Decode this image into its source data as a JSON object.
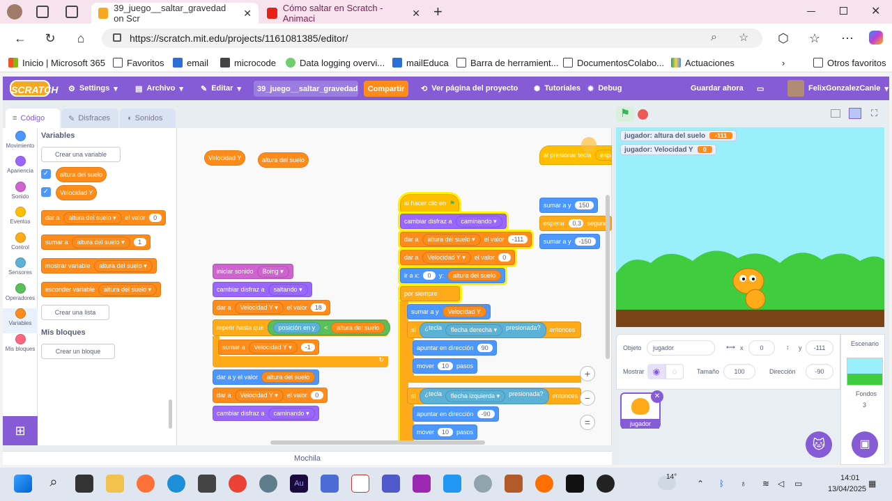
{
  "browser": {
    "tabs": [
      {
        "title": "39_juego__saltar_gravedad on Scr",
        "close": "✕"
      },
      {
        "title": "Cómo saltar en Scratch - Animaci",
        "close": "✕"
      }
    ],
    "new_tab": "+",
    "url": "https://scratch.mit.edu/projects/1161081385/editor/",
    "favorites": [
      "Inicio | Microsoft 365",
      "Favoritos",
      "email",
      "microcode",
      "Data logging overvi...",
      "mailEduca",
      "Barra de herramient...",
      "DocumentosColabo...",
      "Actuaciones"
    ],
    "other_favorites": "Otros favoritos"
  },
  "menubar": {
    "logo": "SCRATCH",
    "settings": "Settings",
    "archivo": "Archivo",
    "editar": "Editar",
    "project_title": "39_juego__saltar_gravedad",
    "share": "Compartir",
    "project_page": "Ver página del proyecto",
    "tutorials": "Tutoriales",
    "debug": "Debug",
    "save": "Guardar ahora",
    "user": "FelixGonzalezCanle"
  },
  "editor_tabs": {
    "code": "Código",
    "costumes": "Disfraces",
    "sounds": "Sonidos"
  },
  "categories": [
    {
      "label": "Movimiento",
      "color": "#4c97ff"
    },
    {
      "label": "Apariencia",
      "color": "#9966ff"
    },
    {
      "label": "Sonido",
      "color": "#cf63cf"
    },
    {
      "label": "Eventos",
      "color": "#ffbf00"
    },
    {
      "label": "Control",
      "color": "#ffab19"
    },
    {
      "label": "Sensores",
      "color": "#5cb1d6"
    },
    {
      "label": "Operadores",
      "color": "#59c059"
    },
    {
      "label": "Variables",
      "color": "#ff8c1a"
    },
    {
      "label": "Mis bloques",
      "color": "#ff6680"
    }
  ],
  "palette": {
    "variables_title": "Variables",
    "create_var": "Crear una variable",
    "var1": "altura del suelo",
    "var2": "Velocidad Y",
    "set_block": {
      "a": "dar a",
      "var": "altura del suelo",
      "b": "el valor",
      "v": "0"
    },
    "change_block": {
      "a": "sumar a",
      "var": "altura del suelo",
      "v": "1"
    },
    "show_block": {
      "a": "mostrar variable",
      "var": "altura del suelo"
    },
    "hide_block": {
      "a": "esconder variable",
      "var": "altura del suelo"
    },
    "create_list": "Crear una lista",
    "myblocks_title": "Mis bloques",
    "create_block": "Crear un bloque"
  },
  "workspace": {
    "loose1": "Velocidad Y",
    "loose2": "altura del suelo",
    "s1": {
      "sound": "iniciar sonido",
      "sound_v": "Boing",
      "costume": "cambiar disfraz a",
      "costume_v": "saltando",
      "set": "dar a",
      "set_var": "Velocidad Y",
      "set_b": "el valor",
      "set_v": "18",
      "repeat": "repetir hasta que",
      "pos": "posición en y",
      "lt": "<",
      "ground": "altura del suelo",
      "change": "sumar a",
      "change_var": "Velocidad Y",
      "change_v": "-1",
      "set2": "dar a y el valor",
      "set2_v": "altura del suelo",
      "set3": "dar a",
      "set3_var": "Velocidad Y",
      "set3_b": "el valor",
      "set3_v": "0",
      "costume2": "cambiar disfraz a",
      "costume2_v": "caminando"
    },
    "s2": {
      "hat": "al hacer clic en",
      "costume": "cambiar disfraz a",
      "costume_v": "caminando",
      "set": "dar a",
      "set_var": "altura del suelo",
      "set_b": "el valor",
      "set_v": "-111",
      "set2": "dar a",
      "set2_var": "Velocidad Y",
      "set2_b": "el valor",
      "set2_v": "0",
      "goto": "ir a x:",
      "goto_x": "0",
      "goto_y": "y:",
      "goto_yv": "altura del suelo",
      "forever": "por siempre",
      "change": "sumar a y",
      "change_v": "Velocidad Y",
      "if": "si",
      "key": "¿tecla",
      "key_v": "flecha derecha",
      "pressed": "presionada?",
      "then": "entonces",
      "point": "apuntar en dirección",
      "point_v": "90",
      "move": "mover",
      "move_v": "10",
      "steps": "pasos",
      "if2": "si",
      "key2": "¿tecla",
      "key2_v": "flecha izquierda",
      "pressed2": "presionada?",
      "then2": "entonces",
      "point2": "apuntar en dirección",
      "point2_v": "-90",
      "move2": "mover",
      "move2_v": "10",
      "steps2": "pasos"
    },
    "s3": {
      "hat": "al presionar tecla",
      "hat_v": "espac",
      "c1": "sumar a y",
      "c1_v": "150",
      "wait": "esperar",
      "wait_v": "0.3",
      "wait_u": "segund",
      "c2": "sumar a y",
      "c2_v": "-150"
    },
    "backpack": "Mochila"
  },
  "stage": {
    "monitor1_label": "jugador: altura del suelo",
    "monitor1_value": "-111",
    "monitor2_label": "jugador: Velocidad Y",
    "monitor2_value": "0"
  },
  "sprite_info": {
    "object_label": "Objeto",
    "object_name": "jugador",
    "x_label": "x",
    "x_value": "0",
    "y_label": "y",
    "y_value": "-111",
    "show_label": "Mostrar",
    "size_label": "Tamaño",
    "size_value": "100",
    "dir_label": "Dirección",
    "dir_value": "-90"
  },
  "sprite_list": {
    "sprite": "jugador"
  },
  "stage_panel": {
    "title": "Escenario",
    "backdrops_label": "Fondos",
    "backdrops_count": "3"
  },
  "taskbar": {
    "temp": "14°",
    "time": "14:01",
    "date": "13/04/2025"
  }
}
